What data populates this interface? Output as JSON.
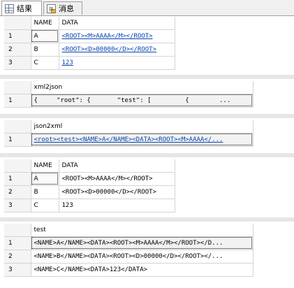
{
  "tabs": [
    {
      "label": "结果",
      "icon": "results-grid-icon"
    },
    {
      "label": "消息",
      "icon": "messages-icon"
    }
  ],
  "grids": [
    {
      "columns": [
        "NAME",
        "DATA"
      ],
      "rows": [
        {
          "n": "1",
          "name": "A",
          "data": "<ROOT><M>AAAA</M></ROOT>"
        },
        {
          "n": "2",
          "name": "B",
          "data": "<ROOT><D>00000</D></ROOT>"
        },
        {
          "n": "3",
          "name": "C",
          "data": "123"
        }
      ]
    },
    {
      "columns": [
        "xml2json"
      ],
      "rows": [
        {
          "n": "1",
          "value": "{     \"root\": {       \"test\": [         {        ..."
        }
      ]
    },
    {
      "columns": [
        "json2xml"
      ],
      "rows": [
        {
          "n": "1",
          "value": "<root><test><NAME>A</NAME><DATA><ROOT><M>AAAA</..."
        }
      ]
    },
    {
      "columns": [
        "NAME",
        "DATA"
      ],
      "rows": [
        {
          "n": "1",
          "name": "A",
          "data": "<ROOT><M>AAAA</M></ROOT>"
        },
        {
          "n": "2",
          "name": "B",
          "data": "<ROOT><D>00000</D></ROOT>"
        },
        {
          "n": "3",
          "name": "C",
          "data": "123"
        }
      ]
    },
    {
      "columns": [
        "test"
      ],
      "rows": [
        {
          "n": "1",
          "value": "<NAME>A</NAME><DATA><ROOT><M>AAAA</M></ROOT></D..."
        },
        {
          "n": "2",
          "value": "<NAME>B</NAME><DATA><ROOT><D>00000</D></ROOT></..."
        },
        {
          "n": "3",
          "value": "<NAME>C</NAME><DATA>123</DATA>"
        }
      ]
    }
  ]
}
